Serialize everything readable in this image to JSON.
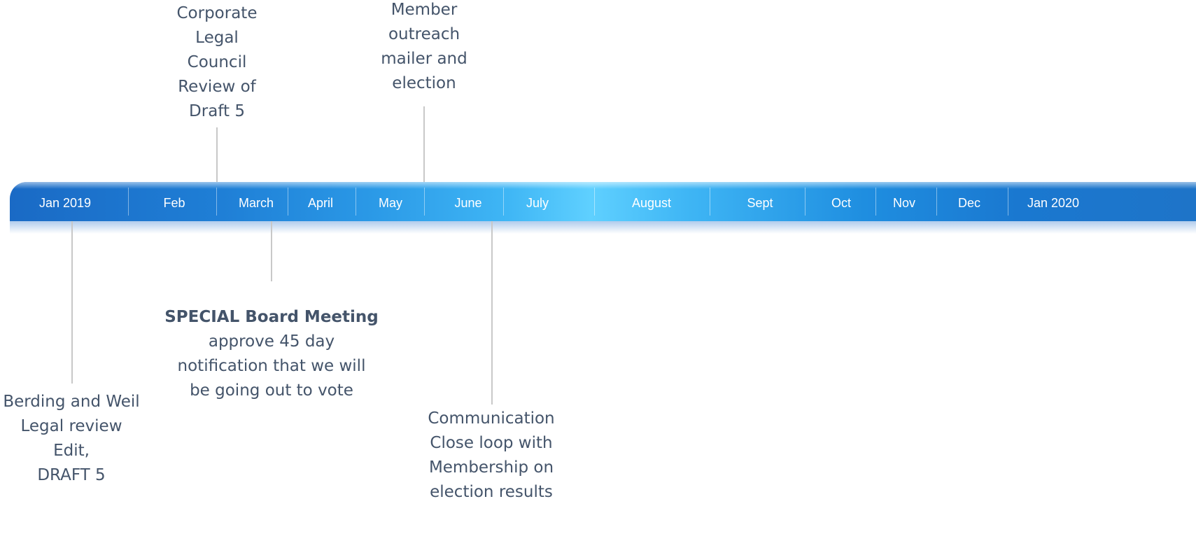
{
  "timeline": {
    "months": [
      "Jan 2019",
      "Feb",
      "March",
      "April",
      "May",
      "June",
      "July",
      "August",
      "Sept",
      "Oct",
      "Nov",
      "Dec",
      "Jan 2020"
    ]
  },
  "events": {
    "corporate_review": [
      "Corporate",
      "Legal",
      "Council",
      "Review of",
      "Draft 5"
    ],
    "member_outreach": [
      "Member",
      "outreach",
      "mailer and",
      "election"
    ],
    "legal_review": [
      "Berding and Weil",
      "Legal review",
      "Edit,",
      "DRAFT 5"
    ],
    "special_meeting": {
      "title": "SPECIAL Board Meeting",
      "lines": [
        "approve 45 day",
        "notification that we will",
        "be going out to vote"
      ]
    },
    "communication": [
      "Communication",
      "Close loop with",
      "Membership on",
      "election results"
    ]
  },
  "colors": {
    "bar_dark": "#1a6ac5",
    "bar_light": "#5fd0ff",
    "annotation_text": "#44546a",
    "connector": "#c8c8c8"
  }
}
